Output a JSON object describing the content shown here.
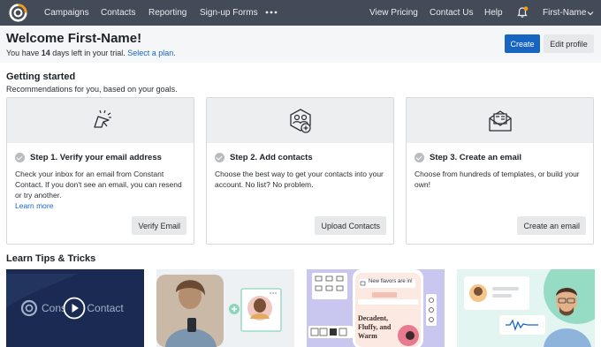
{
  "nav": {
    "items": [
      "Campaigns",
      "Contacts",
      "Reporting",
      "Sign-up Forms"
    ],
    "right_items": [
      "View Pricing",
      "Contact Us",
      "Help"
    ],
    "user": "First-Name",
    "more_icon": "more-dots-icon",
    "bell_icon": "bell-icon",
    "accent": "#f39c12"
  },
  "header": {
    "title": "Welcome First-Name!",
    "trial_prefix": "You have ",
    "trial_days": "14",
    "trial_suffix": " days left in your trial. ",
    "trial_link": "Select a plan.",
    "create_label": "Create",
    "edit_label": "Edit profile"
  },
  "getting_started": {
    "title": "Getting started",
    "subtitle": "Recommendations for you, based on your goals.",
    "cards": [
      {
        "icon": "cursor-click-icon",
        "title": "Step 1. Verify your email address",
        "desc": "Check your inbox for an email from Constant Contact. If you don't see an email, you can resend or try another.",
        "link": "Learn more",
        "button": "Verify Email"
      },
      {
        "icon": "contacts-add-icon",
        "title": "Step 2. Add contacts",
        "desc": "Choose the best way to get your contacts into your account. No list? No problem.",
        "button": "Upload Contacts"
      },
      {
        "icon": "email-envelope-icon",
        "title": "Step 3. Create an email",
        "desc": "Choose from hundreds of templates, or build your own!",
        "button": "Create an email"
      }
    ]
  },
  "tips": {
    "title": "Learn Tips & Tricks",
    "video_brand": "Constant Contact",
    "phone_banner": "New flavors are in!",
    "phone_headline": "Decadent, Fluffy, and Warm"
  },
  "colors": {
    "primary": "#1765c1",
    "nav_bg": "#424b57"
  }
}
